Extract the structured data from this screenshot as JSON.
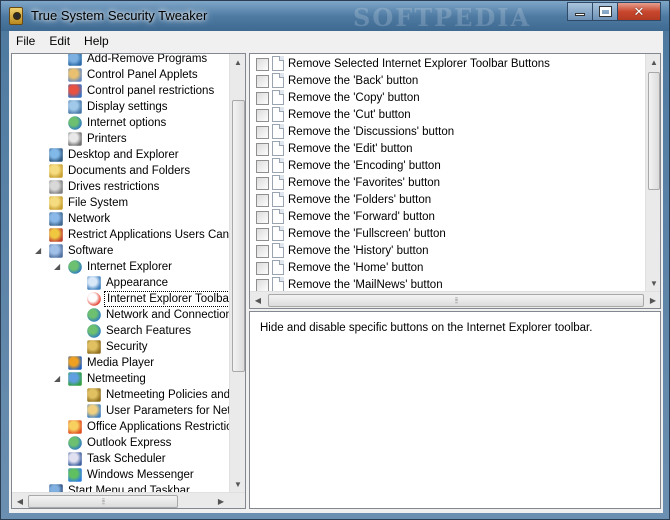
{
  "window": {
    "title": "True System Security Tweaker",
    "watermark": "SOFTPEDIA",
    "colors": {
      "titlebar": "#4f7ba3",
      "close_button": "#c8472e",
      "client_bg": "#f0f0f0"
    }
  },
  "menu": [
    "File",
    "Edit",
    "Help"
  ],
  "tree": [
    {
      "label": "Add-Remove Programs",
      "level": 3,
      "icon": "programs-icon"
    },
    {
      "label": "Control Panel Applets",
      "level": 3,
      "icon": "control-panel-icon"
    },
    {
      "label": "Control panel restrictions",
      "level": 3,
      "icon": "restrictions-icon"
    },
    {
      "label": "Display settings",
      "level": 3,
      "icon": "display-icon"
    },
    {
      "label": "Internet options",
      "level": 3,
      "icon": "globe-icon"
    },
    {
      "label": "Printers",
      "level": 3,
      "icon": "printer-icon"
    },
    {
      "label": "Desktop and Explorer",
      "level": 2,
      "icon": "desktop-icon"
    },
    {
      "label": "Documents and Folders",
      "level": 2,
      "icon": "folder-icon"
    },
    {
      "label": "Drives restrictions",
      "level": 2,
      "icon": "drive-icon"
    },
    {
      "label": "File System",
      "level": 2,
      "icon": "folder-icon"
    },
    {
      "label": "Network",
      "level": 2,
      "icon": "network-icon"
    },
    {
      "label": "Restrict Applications Users Can Ru",
      "level": 2,
      "icon": "shield-icon"
    },
    {
      "label": "Software",
      "level": 2,
      "icon": "software-icon",
      "expanded": true
    },
    {
      "label": "Internet Explorer",
      "level": 3,
      "icon": "globe-icon",
      "expanded": true
    },
    {
      "label": "Appearance",
      "level": 4,
      "icon": "window-icon"
    },
    {
      "label": "Internet Explorer Toolbar",
      "level": 4,
      "icon": "record-icon",
      "selected": true
    },
    {
      "label": "Network and Connections",
      "level": 4,
      "icon": "globe-icon"
    },
    {
      "label": "Search Features",
      "level": 4,
      "icon": "globe-icon"
    },
    {
      "label": "Security",
      "level": 4,
      "icon": "keys-icon"
    },
    {
      "label": "Media Player",
      "level": 3,
      "icon": "media-player-icon"
    },
    {
      "label": "Netmeeting",
      "level": 3,
      "icon": "netmeeting-icon",
      "expanded": true
    },
    {
      "label": "Netmeeting Policies and",
      "level": 4,
      "icon": "keys-icon"
    },
    {
      "label": "User Parameters for Net",
      "level": 4,
      "icon": "users-icon"
    },
    {
      "label": "Office Applications Restrictions",
      "level": 3,
      "icon": "office-icon"
    },
    {
      "label": "Outlook Express",
      "level": 3,
      "icon": "globe-icon"
    },
    {
      "label": "Task Scheduler",
      "level": 3,
      "icon": "scheduler-icon"
    },
    {
      "label": "Windows Messenger",
      "level": 3,
      "icon": "messenger-icon"
    },
    {
      "label": "Start Menu and Taskbar",
      "level": 2,
      "icon": "start-menu-icon"
    }
  ],
  "options": [
    "Remove Selected Internet Explorer Toolbar Buttons",
    "Remove the 'Back' button",
    "Remove the 'Copy' button",
    "Remove the 'Cut' button",
    "Remove the 'Discussions' button",
    "Remove the 'Edit' button",
    "Remove the 'Encoding' button",
    "Remove the 'Favorites' button",
    "Remove the 'Folders' button",
    "Remove the 'Forward' button",
    "Remove the 'Fullscreen' button",
    "Remove the 'History' button",
    "Remove the 'Home' button",
    "Remove the 'MailNews' button"
  ],
  "description": "Hide and disable specific buttons on the Internet Explorer toolbar."
}
